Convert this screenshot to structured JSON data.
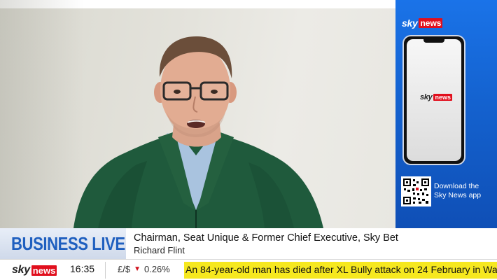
{
  "brand": {
    "logo_sky": "sky",
    "logo_news": "news",
    "accent_red": "#e10f1d",
    "accent_blue": "#1a73e8",
    "ticker_yellow": "#f6e81f"
  },
  "promo": {
    "download_line1": "Download the",
    "download_line2": "Sky News app",
    "qr_icon": "qr-code-icon",
    "phone_icon": "smartphone-icon"
  },
  "lower_third": {
    "programme": "BUSINESS LIVE",
    "title": "Chairman, Seat Unique & Former Chief Executive, Sky Bet",
    "name": "Richard Flint"
  },
  "ticker": {
    "time": "16:35",
    "fx_pair": "£/$",
    "fx_direction": "down",
    "fx_change": "0.26%",
    "headline": "An 84-year-old man has died after XL Bully attack on 24 February in Wa"
  }
}
